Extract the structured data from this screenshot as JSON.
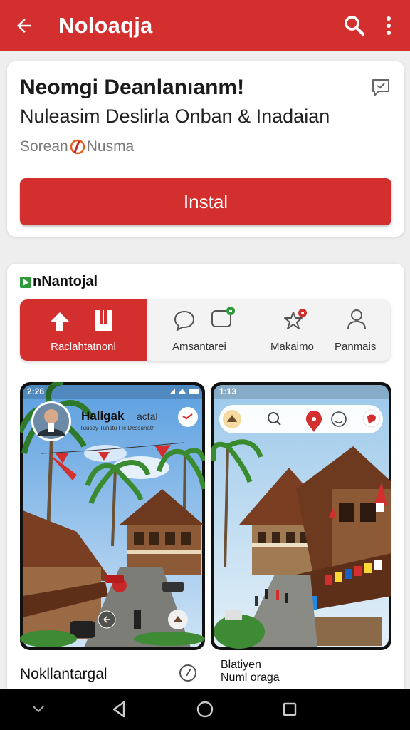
{
  "appbar": {
    "title": "Noloaqja",
    "icons": [
      "back-arrow-icon",
      "search-icon",
      "more-vert-icon"
    ],
    "color": "#d32f2f"
  },
  "app_info": {
    "name": "Neomgi Deanlanıanm!",
    "subtitle": "Nuleasim Deslirla Onban & Inadaian",
    "developer_prefix": "Sorean",
    "developer_suffix": "Nusma",
    "install_label": "Instal"
  },
  "section": {
    "title": "nNantojal"
  },
  "features": [
    {
      "label": "Raclahtatnonl",
      "active": true,
      "icons": [
        "arrow-up-icon",
        "bookmark-icon"
      ]
    },
    {
      "label": "Amsantarei",
      "active": false,
      "icons": [
        "chat-bubble-icon",
        "message-badge-icon"
      ]
    },
    {
      "label": "Makaimo",
      "active": false,
      "icons": [
        "pin-star-icon"
      ]
    },
    {
      "label": "Panmais",
      "active": false,
      "icons": [
        "person-icon"
      ]
    }
  ],
  "screenshot_left": {
    "status_time": "2:26",
    "profile_name": "Haligak",
    "profile_tag": "actal",
    "profile_desc": "Tuusdy Tunstu I Ic Dessunath"
  },
  "screenshot_right": {
    "status_time": "1:13"
  },
  "bottom": {
    "left_label": "Nokllantargal",
    "right_line1": "Blatiyen",
    "right_line2": "Numl oraga"
  },
  "colors": {
    "accent": "#d32f2f",
    "background": "#eeeeee",
    "card": "#ffffff"
  }
}
